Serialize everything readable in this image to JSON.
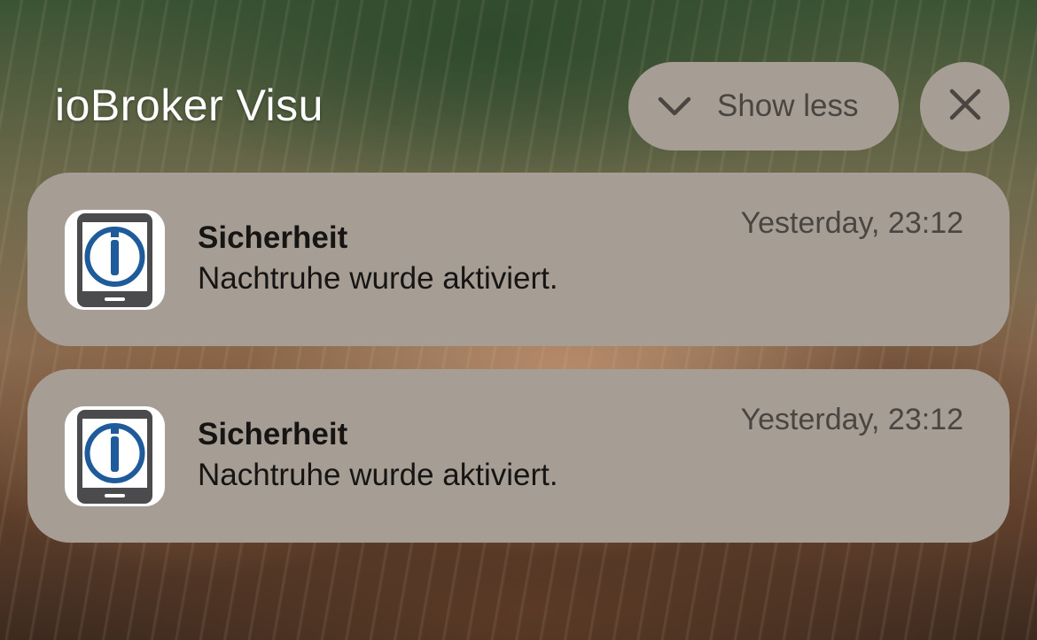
{
  "header": {
    "app_title": "ioBroker Visu",
    "show_less_label": "Show less",
    "show_less_icon": "chevron-down-icon",
    "close_icon": "close-icon"
  },
  "notifications": [
    {
      "app_icon": "iobroker-app-icon",
      "title": "Sicherheit",
      "body": "Nachtruhe wurde aktiviert.",
      "time": "Yesterday, 23:12"
    },
    {
      "app_icon": "iobroker-app-icon",
      "title": "Sicherheit",
      "body": "Nachtruhe wurde aktiviert.",
      "time": "Yesterday, 23:12"
    }
  ],
  "colors": {
    "pill_background": "#a69e95",
    "text_dark": "#161514",
    "text_muted": "#4a4541",
    "app_icon_blue": "#1f5b9b",
    "app_icon_device": "#4b4b4d"
  }
}
